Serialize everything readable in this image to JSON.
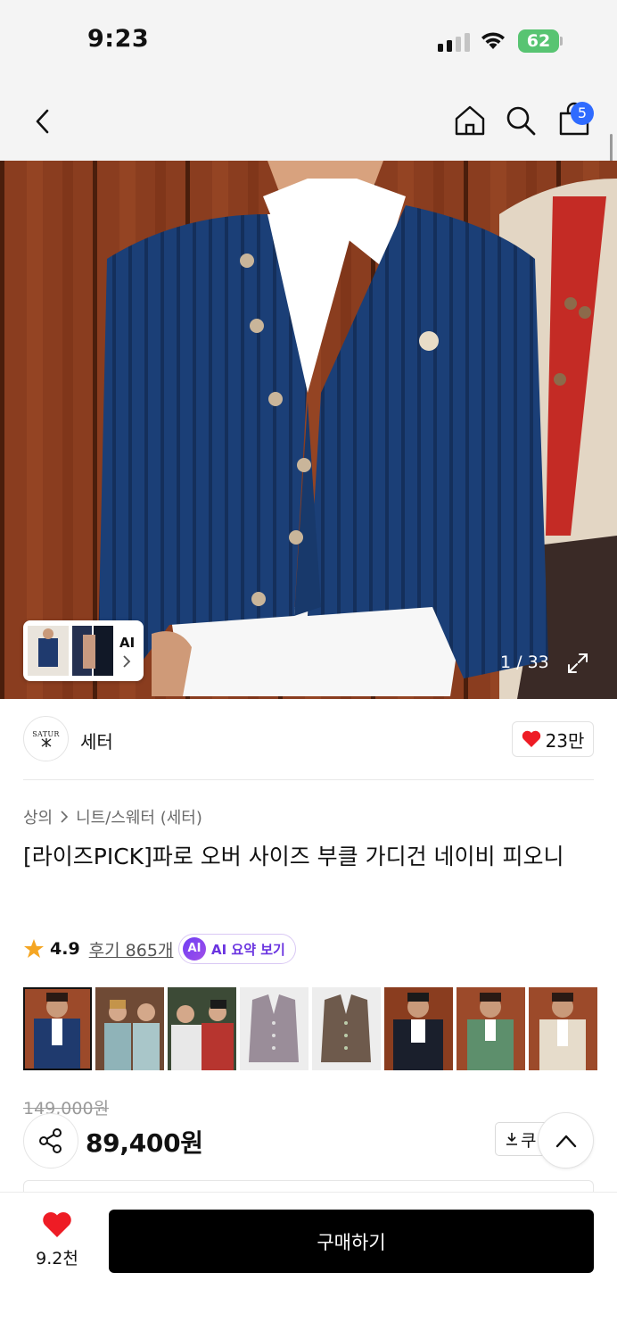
{
  "status_bar": {
    "time": "9:23",
    "battery_level": "62"
  },
  "nav": {
    "cart_count": "5",
    "icons": [
      "chevron-left-icon",
      "home-icon",
      "search-icon",
      "shopping-bag-icon"
    ]
  },
  "gallery": {
    "counter": "1 / 33",
    "ai_label": "AI",
    "icons": [
      "expand-icon",
      "chevron-right-icon"
    ]
  },
  "brand": {
    "logo_text": "SATUR",
    "name": "세터",
    "like_count": "23만"
  },
  "breadcrumb": {
    "items": [
      "상의",
      "니트/스웨터 (세터)"
    ]
  },
  "product": {
    "title": "[라이즈PICK]파로 오버 사이즈 부클 가디건 네이비 피오니",
    "rating": "4.9",
    "review_link": "후기 865개",
    "ai_summary_badge": "AI",
    "ai_summary_label": "AI 요약 보기"
  },
  "color_options": {
    "count": 8,
    "selected_index": 0,
    "swatch_colors": [
      "#1f3a6e",
      "#8fb3b8",
      "#b7352f",
      "#9a8d99",
      "#6e5a4c",
      "#1a1f2c",
      "#5d8f6c",
      "#e6dccb"
    ]
  },
  "price": {
    "original": "149,000원",
    "sale": "89,400원",
    "coupon_label": "쿠"
  },
  "bottom_bar": {
    "wish_count": "9.2천",
    "buy_label": "구매하기"
  },
  "colors": {
    "accent_blue": "#2f6bff",
    "heart_red": "#ee1c25",
    "ai_purple": "#6a34e0",
    "battery_green": "#58c472"
  }
}
